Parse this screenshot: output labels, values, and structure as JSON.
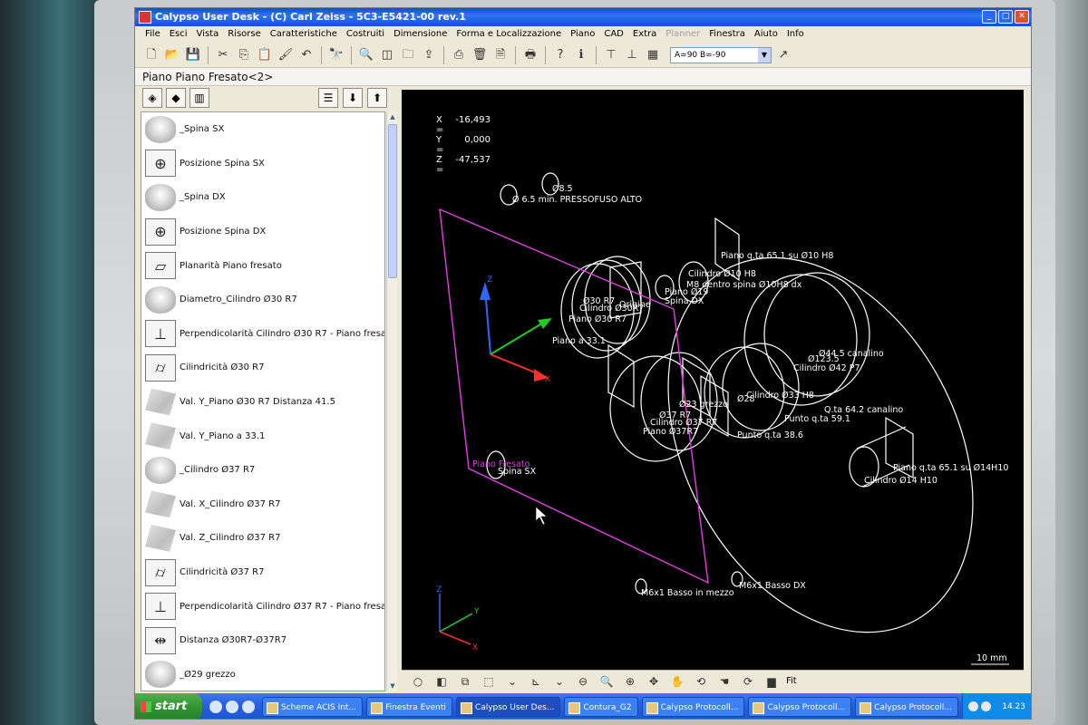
{
  "window": {
    "title": "Calypso User Desk - (C) Carl Zeiss - 5C3-E5421-00 rev.1",
    "buttons": {
      "minimize": "_",
      "maximize": "□",
      "close": "✕"
    }
  },
  "menu": [
    "File",
    "Esci",
    "Vista",
    "Risorse",
    "Caratteristiche",
    "Costruiti",
    "Dimensione",
    "Forma e Localizzazione",
    "Piano",
    "CAD",
    "Extra",
    "Planner",
    "Finestra",
    "Aiuto",
    "Info"
  ],
  "menu_disabled": "Planner",
  "toolbar": {
    "icons": [
      "new-icon",
      "open-icon",
      "save-icon",
      "cut-icon",
      "copy-icon",
      "paste-icon",
      "brush-icon",
      "undo-icon",
      "binoculars-icon",
      "zoom-icon",
      "view-icon",
      "folder-icon",
      "export-icon",
      "print-icon",
      "delete-icon",
      "page-icon",
      "printer-icon",
      "help-icon",
      "info-icon",
      "probe-icon",
      "probe-alt-icon",
      "probe-config-icon"
    ],
    "angle_combo": "A=90 B=-90"
  },
  "breadcrumb": "Piano  Piano Fresato<2>",
  "features": [
    {
      "label": "_Spina SX",
      "icon": "cylinder"
    },
    {
      "label": "Posizione Spina SX",
      "icon": "position"
    },
    {
      "label": "_Spina DX",
      "icon": "cylinder"
    },
    {
      "label": "Posizione Spina DX",
      "icon": "position"
    },
    {
      "label": "Planarità Piano fresato",
      "icon": "flatness"
    },
    {
      "label": "Diametro_Cilindro Ø30 R7",
      "icon": "cylinder"
    },
    {
      "label": "Perpendicolarità Cilindro Ø30 R7 - Piano fresat",
      "icon": "perpendicularity"
    },
    {
      "label": "Cilindricità Ø30 R7",
      "icon": "cylindricity"
    },
    {
      "label": "Val. Y_Piano Ø30 R7 Distanza 41.5",
      "icon": "block"
    },
    {
      "label": "Val. Y_Piano a 33.1",
      "icon": "block"
    },
    {
      "label": "_Cilindro Ø37 R7",
      "icon": "cylinder"
    },
    {
      "label": "Val. X_Cilindro Ø37 R7",
      "icon": "block"
    },
    {
      "label": "Val. Z_Cilindro Ø37 R7",
      "icon": "block"
    },
    {
      "label": "Cilindricità Ø37 R7",
      "icon": "cylindricity"
    },
    {
      "label": "Perpendicolarità Cilindro Ø37 R7 - Piano fresa",
      "icon": "perpendicularity"
    },
    {
      "label": "Distanza Ø30R7-Ø37R7",
      "icon": "distance"
    },
    {
      "label": "_Ø29 grezzo",
      "icon": "cylinder"
    }
  ],
  "coords": [
    {
      "axis": "X =",
      "value": "-16,493"
    },
    {
      "axis": "Y =",
      "value": "0,000"
    },
    {
      "axis": "Z =",
      "value": "-47,537"
    }
  ],
  "viewport_labels": {
    "l1": "Ø 6.5 min. PRESSOFUSO ALTO",
    "l2": "Ø8.5",
    "l3": "Piano q.ta 65.1 su Ø10 H8",
    "l4": "Cilindro Ø10 H8",
    "l5": "M8 dentro spina Ø10H8 dx",
    "l6": "Piano Ø19",
    "l7": "Spina DX",
    "l8": "Ø30 R7",
    "l9": "Cilindro Ø30R7",
    "l10": "Origine",
    "l11": "Piano Ø30 R7",
    "l12": "Piano a 33.1",
    "l13": "Ø44.5 canalino",
    "l14": "Ø123.5",
    "l15": "Cilindro Ø42 P7",
    "l16": "Cilindro Ø33 H8",
    "l17": "Ø28",
    "l18": "Ø23 grezzo",
    "l19": "Ø37 R7",
    "l20": "Cilindro Ø37 R7",
    "l21": "Piano Ø37R7",
    "l22": "Q.ta 64.2 canalino",
    "l23": "Punto q.ta 59.1",
    "l24": "Punto q.ta 38.6",
    "l25": "Piano q.ta 65.1 su Ø14H10",
    "l26": "Cilindro Ø14 H10",
    "l27": "Piano Fresato",
    "l28": "Spina SX",
    "l29": "M6x1 Basso in mezzo",
    "l30": "M6x1 Basso DX",
    "scale": "10 mm",
    "axis_x": "X",
    "axis_y": "Y",
    "axis_z": "Z"
  },
  "view_toolbar": {
    "fit": "Fit"
  },
  "taskbar": {
    "start": "start",
    "tasks": [
      "Scheme ACIS Int...",
      "Finestra Eventi",
      "Calypso User Des...",
      "Contura_G2",
      "Calypso Protocoll...",
      "Calypso Protocoll...",
      "Calypso Protocoll..."
    ],
    "active_task": "Calypso User Des...",
    "clock": "14.23"
  },
  "colors": {
    "titlebar": "#0a4fd8",
    "viewport_bg": "#000000",
    "plane": "#e040e0",
    "axis_x": "#ff3030",
    "axis_y": "#22cc22",
    "axis_z": "#3366ff"
  }
}
